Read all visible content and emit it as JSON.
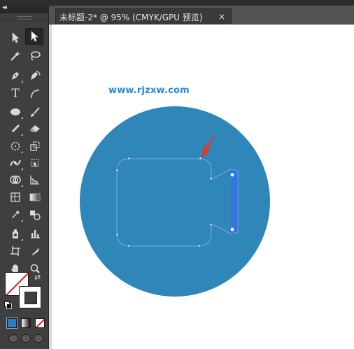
{
  "document_tab": {
    "title": "未标题-2* @ 95% (CMYK/GPU 预览)",
    "close_glyph": "×"
  },
  "tool_panel": {
    "collapse_glyph": "◂◂",
    "tools": [
      {
        "name": "selection-tool",
        "icon": "arrow-icon"
      },
      {
        "name": "direct-selection-tool",
        "icon": "white-arrow-icon",
        "active": true
      },
      {
        "name": "magic-wand-tool",
        "icon": "magic-wand-icon"
      },
      {
        "name": "lasso-tool",
        "icon": "lasso-icon"
      },
      {
        "name": "pen-tool",
        "icon": "pen-icon"
      },
      {
        "name": "curvature-tool",
        "icon": "curvature-pen-icon"
      },
      {
        "name": "type-tool",
        "icon": "type-icon",
        "label": "T"
      },
      {
        "name": "line-segment-tool",
        "icon": "arc-icon"
      },
      {
        "name": "ellipse-tool",
        "icon": "ellipse-icon"
      },
      {
        "name": "paintbrush-tool",
        "icon": "brush-icon"
      },
      {
        "name": "pencil-tool",
        "icon": "pencil-icon"
      },
      {
        "name": "eraser-tool",
        "icon": "eraser-icon"
      },
      {
        "name": "rotate-tool",
        "icon": "rotate-icon"
      },
      {
        "name": "scale-tool",
        "icon": "scale-icon"
      },
      {
        "name": "width-tool",
        "icon": "width-icon"
      },
      {
        "name": "free-transform-tool",
        "icon": "free-transform-icon"
      },
      {
        "name": "shape-builder-tool",
        "icon": "shape-builder-icon"
      },
      {
        "name": "perspective-grid-tool",
        "icon": "perspective-grid-icon"
      },
      {
        "name": "mesh-tool",
        "icon": "mesh-icon"
      },
      {
        "name": "gradient-tool",
        "icon": "gradient-icon"
      },
      {
        "name": "eyedropper-tool",
        "icon": "eyedropper-icon"
      },
      {
        "name": "blend-tool",
        "icon": "blend-icon"
      },
      {
        "name": "symbol-sprayer-tool",
        "icon": "symbol-sprayer-icon"
      },
      {
        "name": "column-graph-tool",
        "icon": "column-graph-icon"
      },
      {
        "name": "artboard-tool",
        "icon": "artboard-icon"
      },
      {
        "name": "slice-tool",
        "icon": "slice-icon"
      },
      {
        "name": "hand-tool",
        "icon": "hand-icon"
      },
      {
        "name": "zoom-tool",
        "icon": "zoom-icon"
      }
    ]
  },
  "fill_stroke": {
    "fill": "none",
    "stroke": "none",
    "swap_glyph": "⇄"
  },
  "canvas": {
    "watermark": "www.rjzxw.com",
    "circle_color": "#2e86b9",
    "path_color": "#7aa7ff",
    "anchor_color": "#3d6cf0",
    "arrow_color": "#e8352b"
  }
}
